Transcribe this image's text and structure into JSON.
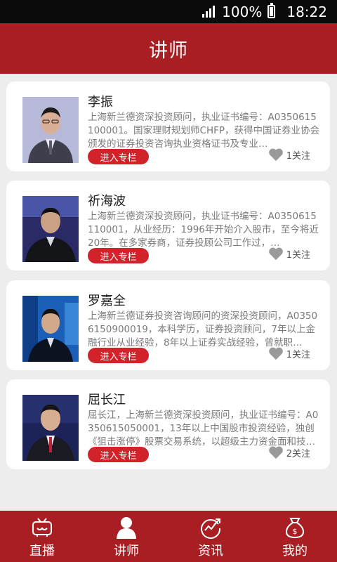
{
  "status": {
    "battery": "100%",
    "time": "18:22"
  },
  "header": {
    "title": "讲师"
  },
  "lecturers": [
    {
      "name": "李振",
      "desc": "上海新兰德资深投资顾问，执业证书编号：A0350615100001。国家理财规划师CHFP，获得中国证券业协会颁发的证券投资咨询执业资格证书及专业…",
      "button": "进入专栏",
      "follow": "1关注"
    },
    {
      "name": "祈海波",
      "desc": "上海新兰德资深投资顾问，执业证书编号：A0350615110001，从业经历：1996年开始介入股市，至今将近20年。在多家券商，证券投顾公司工作过，…",
      "button": "进入专栏",
      "follow": "1关注"
    },
    {
      "name": "罗嘉全",
      "desc": "上海新兰德证券投资咨询顾问的资深投资顾问，A03506150900019，本科学历，证券投资顾问，7年以上金融行业从业经验，8年以上证券实战经验，曾就职…",
      "button": "进入专栏",
      "follow": "1关注"
    },
    {
      "name": "屈长江",
      "desc": "屈长江，上海新兰德资深投资顾问，执业证书编号：A0350615050001，13年以上中国股市投资经验，独创《狙击涨停》股票交易系统，以超级主力资金面和技…",
      "button": "进入专栏",
      "follow": "2关注"
    }
  ],
  "nav": [
    {
      "label": "直播",
      "icon": "tv-icon"
    },
    {
      "label": "讲师",
      "icon": "person-icon"
    },
    {
      "label": "资讯",
      "icon": "news-icon"
    },
    {
      "label": "我的",
      "icon": "moneybag-icon"
    }
  ],
  "colors": {
    "brand": "#a81e22",
    "button": "#d3232a",
    "heart": "#9a9a9a"
  }
}
